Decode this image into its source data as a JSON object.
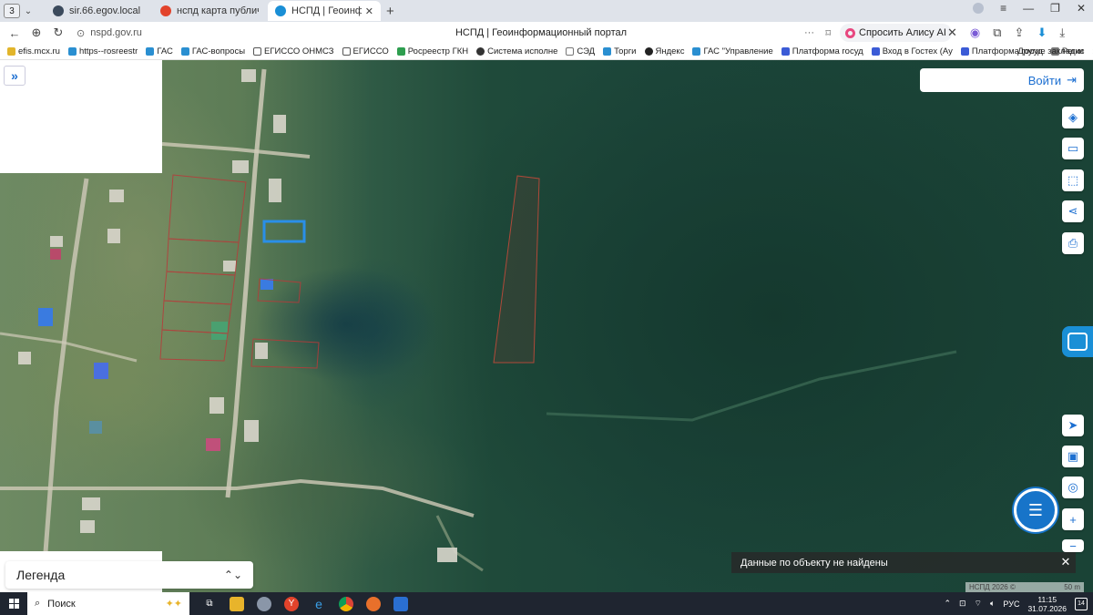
{
  "browser": {
    "tab_counter": "3",
    "tabs": [
      {
        "label": "sir.66.egov.local",
        "favicon_color": "#3b4a5c"
      },
      {
        "label": "нспд карта публичная кад",
        "favicon_color": "#e2432b"
      },
      {
        "label": "НСПД | Геоинформацио",
        "favicon_color": "#1a8fd6"
      }
    ],
    "url": "nspd.gov.ru",
    "page_title": "НСПД | Геоинформационный портал",
    "more_glyph": "···",
    "alice_label": "Спросить Алису AI"
  },
  "bookmarks": [
    {
      "label": "efis.mcx.ru",
      "color": "#e2b52b"
    },
    {
      "label": "https--rosreestr",
      "color": "#2a8fd1"
    },
    {
      "label": "ГАС",
      "color": "#2a8fd1"
    },
    {
      "label": "ГАС-вопросы",
      "color": "#2a8fd1"
    },
    {
      "label": "ЕГИССО ОНМСЗ",
      "color": "#555555"
    },
    {
      "label": "ЕГИССО",
      "color": "#555555"
    },
    {
      "label": "Росреестр ГКН",
      "color": "#2e9e4f"
    },
    {
      "label": "Система исполне",
      "color": "#333333"
    },
    {
      "label": "СЭД",
      "color": "#777777"
    },
    {
      "label": "Торги",
      "color": "#2a8fd1"
    },
    {
      "label": "Яндекс",
      "color": "#222222"
    },
    {
      "label": "ГАС \"Управление",
      "color": "#2a8fd1"
    },
    {
      "label": "Платформа госуд",
      "color": "#3b5bd6"
    },
    {
      "label": "Вход в Гостех (Ау",
      "color": "#3b5bd6"
    },
    {
      "label": "Платформа госуд",
      "color": "#3b5bd6"
    },
    {
      "label": "Регис",
      "color": "#777777"
    }
  ],
  "bookmarks_other": "Другие закладки",
  "map": {
    "login_label": "Войти",
    "legend_label": "Легенда",
    "toast_message": "Данные по объекту не найдены",
    "copyright": "НСПД 2026 ©",
    "scale_label": "50 m"
  },
  "taskbar": {
    "search_placeholder": "Поиск",
    "language": "РУС",
    "time": "11:15",
    "date": "31.07.2026",
    "notifications": "14"
  }
}
